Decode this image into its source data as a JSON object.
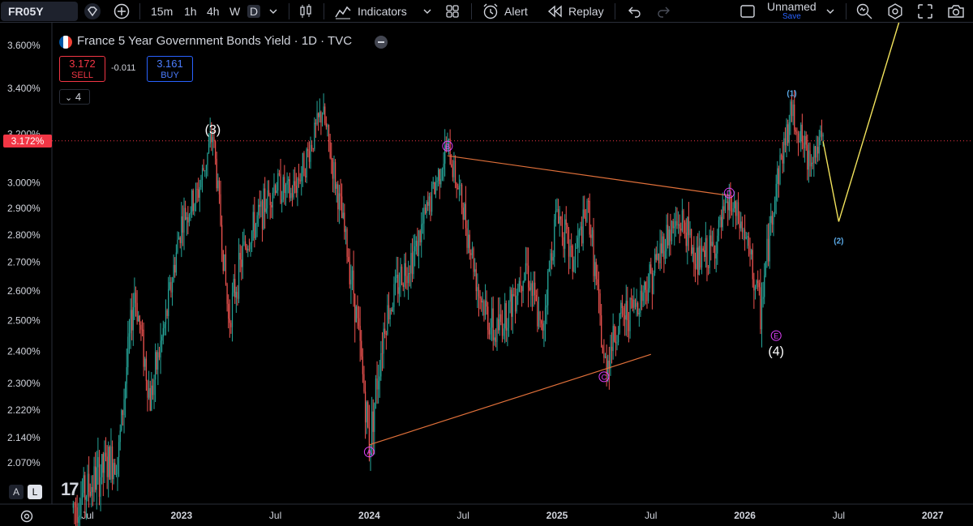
{
  "toolbar": {
    "symbol": "FR05Y",
    "intervals": [
      "15m",
      "1h",
      "4h",
      "W",
      "D"
    ],
    "active_interval": "D",
    "indicators_label": "Indicators",
    "alert_label": "Alert",
    "replay_label": "Replay",
    "layout_name": "Unnamed",
    "save_label": "Save"
  },
  "legend": {
    "title": "France 5 Year Government Bonds Yield · 1D · TVC",
    "sell_price": "3.172",
    "sell_label": "SELL",
    "spread": "-0.011",
    "buy_price": "3.161",
    "buy_label": "BUY",
    "collapsed_count": "4"
  },
  "colors": {
    "up": "#26a69a",
    "down": "#ef5350",
    "trendline": "#e0703a",
    "projection": "#f2e35c",
    "wave_label_magenta": "#e040fb",
    "wave_label_blue": "#5aa9e6",
    "price_tag": "#f23645"
  },
  "scale_buttons": [
    "A",
    "L"
  ],
  "chart_data": {
    "type": "candlestick",
    "title": "France 5 Year Government Bonds Yield · 1D · TVC",
    "current_price": "3.172%",
    "y_ticks": [
      "3.600%",
      "3.400%",
      "3.200%",
      "3.000%",
      "2.900%",
      "2.800%",
      "2.700%",
      "2.600%",
      "2.500%",
      "2.400%",
      "2.300%",
      "2.220%",
      "2.140%",
      "2.070%"
    ],
    "x_ticks": [
      "Jul",
      "2023",
      "Jul",
      "2024",
      "Jul",
      "2025",
      "Jul",
      "2026",
      "Jul",
      "2027"
    ],
    "wave_labels": [
      {
        "text": "(3)",
        "date": "2023-03",
        "price": 3.22
      },
      {
        "text": "A",
        "date": "2024-01",
        "price": 2.1
      },
      {
        "text": "B",
        "date": "2024-06",
        "price": 3.15
      },
      {
        "text": "C",
        "date": "2025-04",
        "price": 2.32
      },
      {
        "text": "D",
        "date": "2025-12",
        "price": 2.96
      },
      {
        "text": "E",
        "date": "2026-03",
        "price": 2.45
      },
      {
        "text": "(4)",
        "date": "2026-03",
        "price": 2.4
      },
      {
        "text": "(1)",
        "date": "2026-04",
        "price": 3.38
      },
      {
        "text": "(2)",
        "date": "2026-07",
        "price": 2.78
      }
    ],
    "trendlines": [
      {
        "from": {
          "date": "2024-01",
          "price": 2.12
        },
        "to": {
          "date": "2025-07",
          "price": 2.39
        }
      },
      {
        "from": {
          "date": "2024-06",
          "price": 3.11
        },
        "to": {
          "date": "2025-12",
          "price": 2.95
        }
      }
    ],
    "projection": [
      {
        "date": "2026-06",
        "price": 3.17
      },
      {
        "date": "2026-07",
        "price": 2.85
      },
      {
        "date": "2026-11",
        "price": 3.75
      }
    ],
    "price_path": [
      {
        "date": "2022-06",
        "price": 1.95
      },
      {
        "date": "2022-09",
        "price": 2.1
      },
      {
        "date": "2022-10",
        "price": 2.6
      },
      {
        "date": "2022-11",
        "price": 2.25
      },
      {
        "date": "2022-12",
        "price": 2.5
      },
      {
        "date": "2023-01",
        "price": 2.85
      },
      {
        "date": "2023-02",
        "price": 2.95
      },
      {
        "date": "2023-03",
        "price": 3.2
      },
      {
        "date": "2023-04",
        "price": 2.5
      },
      {
        "date": "2023-05",
        "price": 2.75
      },
      {
        "date": "2023-07",
        "price": 3.0
      },
      {
        "date": "2023-08",
        "price": 2.95
      },
      {
        "date": "2023-09",
        "price": 3.1
      },
      {
        "date": "2023-10",
        "price": 3.3
      },
      {
        "date": "2023-11",
        "price": 2.95
      },
      {
        "date": "2023-12",
        "price": 2.6
      },
      {
        "date": "2024-01",
        "price": 2.12
      },
      {
        "date": "2024-02",
        "price": 2.5
      },
      {
        "date": "2024-03",
        "price": 2.65
      },
      {
        "date": "2024-04",
        "price": 2.75
      },
      {
        "date": "2024-05",
        "price": 2.95
      },
      {
        "date": "2024-06",
        "price": 3.15
      },
      {
        "date": "2024-07",
        "price": 2.9
      },
      {
        "date": "2024-08",
        "price": 2.6
      },
      {
        "date": "2024-09",
        "price": 2.45
      },
      {
        "date": "2024-10",
        "price": 2.55
      },
      {
        "date": "2024-11",
        "price": 2.7
      },
      {
        "date": "2024-12",
        "price": 2.45
      },
      {
        "date": "2025-01",
        "price": 2.9
      },
      {
        "date": "2025-02",
        "price": 2.7
      },
      {
        "date": "2025-03",
        "price": 2.9
      },
      {
        "date": "2025-04",
        "price": 2.35
      },
      {
        "date": "2025-05",
        "price": 2.5
      },
      {
        "date": "2025-06",
        "price": 2.55
      },
      {
        "date": "2025-07",
        "price": 2.65
      },
      {
        "date": "2025-08",
        "price": 2.8
      },
      {
        "date": "2025-09",
        "price": 2.85
      },
      {
        "date": "2025-10",
        "price": 2.7
      },
      {
        "date": "2025-11",
        "price": 2.75
      },
      {
        "date": "2025-12",
        "price": 2.92
      },
      {
        "date": "2026-01",
        "price": 2.8
      },
      {
        "date": "2026-02",
        "price": 2.53
      },
      {
        "date": "2026-03",
        "price": 3.0
      },
      {
        "date": "2026-04",
        "price": 3.3
      },
      {
        "date": "2026-05",
        "price": 3.1
      },
      {
        "date": "2026-06",
        "price": 3.17
      }
    ]
  }
}
